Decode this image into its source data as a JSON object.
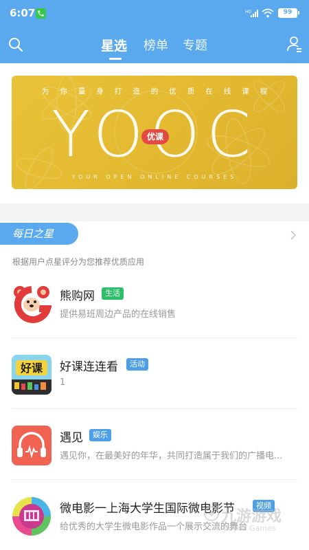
{
  "status": {
    "time": "6:07",
    "signal_label": "HD",
    "battery": "99"
  },
  "nav": {
    "tabs": [
      {
        "label": "星选",
        "active": true
      },
      {
        "label": "榜单",
        "active": false
      },
      {
        "label": "专题",
        "active": false
      }
    ],
    "icons": {
      "left": "search-icon",
      "right": "user-settings-icon"
    }
  },
  "banner": {
    "slogan": "为你量身打造的优质在线课程",
    "brand": "YOOC",
    "badge": "优课",
    "tagline": "YOUR   OPEN   ONLINE   COURSES",
    "color": "#e3b930"
  },
  "section": {
    "title": "每日之星",
    "description": "根据用户点星评分为您推荐优质应用"
  },
  "apps": [
    {
      "name": "熊购网",
      "tag": "生活",
      "tag_color": "#2fbf6a",
      "description": "提供易班周边产品的在线销售",
      "icon": "bear-icon"
    },
    {
      "name": "好课连连看",
      "tag": "活动",
      "tag_color": "#4d9fe8",
      "description": "1",
      "icon": "haoke-icon"
    },
    {
      "name": "遇见",
      "tag": "娱乐",
      "tag_color": "#4d9fe8",
      "description": "遇见你，在最美好的年华，共同打造属于我们的广播电...",
      "icon": "headphones-icon"
    },
    {
      "name": "微电影一上海大学生国际微电影节",
      "tag": "视频",
      "tag_color": "#4d9fe8",
      "description": "给优秀的大学生微电影作品一个展示交流的舞台",
      "icon": "film-reel-icon"
    }
  ],
  "watermark": {
    "title": "九游游戏",
    "subtitle": "Jiuyou Games"
  },
  "colors": {
    "primary": "#5aa9ee",
    "banner": "#e3b930"
  }
}
